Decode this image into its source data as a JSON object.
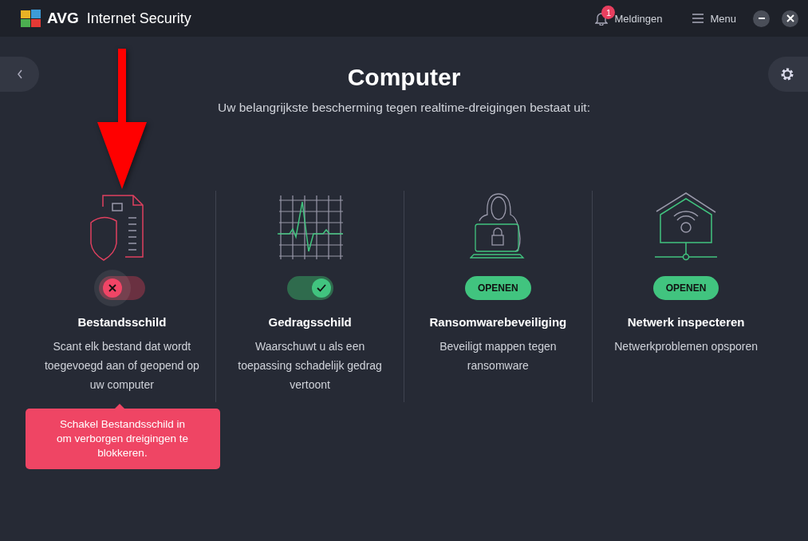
{
  "header": {
    "logo": "AVG",
    "title": "Internet Security",
    "notifications": {
      "count": "1",
      "label": "Meldingen"
    },
    "menu": "Menu"
  },
  "page": {
    "title": "Computer",
    "subtitle": "Uw belangrijkste bescherming tegen realtime-dreigingen bestaat uit:"
  },
  "features": [
    {
      "kind": "toggle",
      "on": false,
      "title": "Bestandsschild",
      "description": "Scant elk bestand dat wordt toegevoegd aan of geopend op uw computer"
    },
    {
      "kind": "toggle",
      "on": true,
      "title": "Gedragsschild",
      "description": "Waarschuwt u als een toepassing schadelijk gedrag vertoont"
    },
    {
      "kind": "button",
      "button": "OPENEN",
      "title": "Ransomwarebeveiliging",
      "description": "Beveiligt mappen tegen ransomware"
    },
    {
      "kind": "button",
      "button": "OPENEN",
      "title": "Netwerk inspecteren",
      "description": "Netwerkproblemen opsporen"
    }
  ],
  "tooltip": "Schakel Bestandsschild in om verborgen dreigingen te blokkeren."
}
